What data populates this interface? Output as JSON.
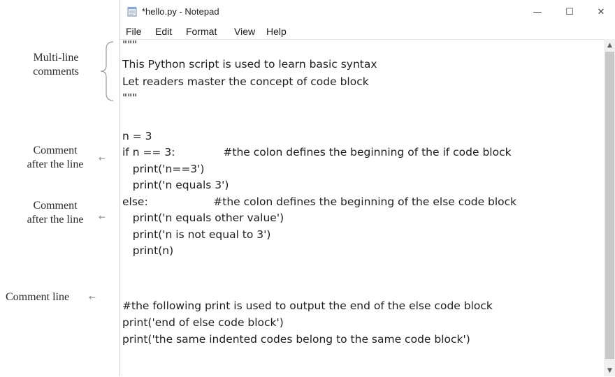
{
  "annotations": {
    "multiline": [
      "Multi-line",
      "comments"
    ],
    "comment_after_1": [
      "Comment",
      "after the line"
    ],
    "comment_after_2": [
      "Comment",
      "after the line"
    ],
    "comment_line": "Comment line",
    "arrow_glyph": "←"
  },
  "window": {
    "title": "*hello.py - Notepad",
    "minimize": "—",
    "maximize": "☐",
    "close": "✕"
  },
  "menu": [
    "File",
    "Edit",
    "Format",
    "View",
    "Help"
  ],
  "scrollbar": {
    "up": "▲",
    "down": "▼"
  },
  "code_lines": [
    "\"\"\"",
    "This Python script is used to learn basic syntax",
    "Let readers master the concept of code block",
    "\"\"\"",
    "",
    "",
    "n = 3",
    "if n == 3:              #the colon defines the beginning of the if code block",
    "   print('n==3')",
    "   print('n equals 3')",
    "else:                   #the colon defines the beginning of the else code block",
    "   print('n equals other value')",
    "   print('n is not equal to 3')",
    "   print(n)",
    "",
    "",
    "#the following print is used to output the end of the else code block",
    "print('end of else code block')",
    "print('the same indented codes belong to the same code block')"
  ]
}
